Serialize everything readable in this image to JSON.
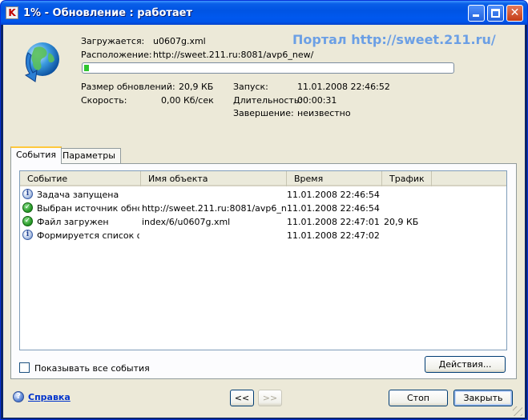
{
  "window": {
    "title": "1% - Обновление : работает",
    "app_icon_glyph": "K",
    "close_glyph": "✕"
  },
  "watermark": "Портал http://sweet.211.ru/",
  "download": {
    "loading_label": "Загружается:",
    "loading_value": "u0607g.xml",
    "location_label": "Расположение:",
    "location_value": "http://sweet.211.ru:8081/avp6_new/",
    "progress_percent": 1
  },
  "stats": {
    "size_label": "Размер обновлений:",
    "size_value": "20,9 КБ",
    "speed_label": "Скорость:",
    "speed_value": "0,00 Кб/сек",
    "start_label": "Запуск:",
    "start_value": "11.01.2008 22:46:52",
    "duration_label": "Длительность:",
    "duration_value": "00:00:31",
    "finish_label": "Завершение:",
    "finish_value": "неизвестно"
  },
  "tabs": [
    {
      "label": "События",
      "active": true
    },
    {
      "label": "Параметры",
      "active": false
    }
  ],
  "events": {
    "columns": [
      "Событие",
      "Имя объекта",
      "Время",
      "Трафик"
    ],
    "rows": [
      {
        "icon": "info-icon",
        "event": "Задача запущена",
        "object": "",
        "time": "11.01.2008 22:46:54",
        "traffic": ""
      },
      {
        "icon": "success-icon",
        "event": "Выбран источник обно...",
        "object": "http://sweet.211.ru:8081/avp6_n...",
        "time": "11.01.2008 22:46:54",
        "traffic": ""
      },
      {
        "icon": "success-icon",
        "event": "Файл загружен",
        "object": "index/6/u0607g.xml",
        "time": "11.01.2008 22:47:01",
        "traffic": "20,9 КБ"
      },
      {
        "icon": "info-icon",
        "event": "Формируется список ф...",
        "object": "",
        "time": "11.01.2008 22:47:02",
        "traffic": ""
      }
    ]
  },
  "show_all_events": {
    "label": "Показывать все события",
    "checked": false
  },
  "buttons": {
    "actions": "Действия...",
    "prev": "<<",
    "next": ">>",
    "stop": "Стоп",
    "close": "Закрыть"
  },
  "help": {
    "label": "Справка",
    "icon_glyph": "?"
  }
}
